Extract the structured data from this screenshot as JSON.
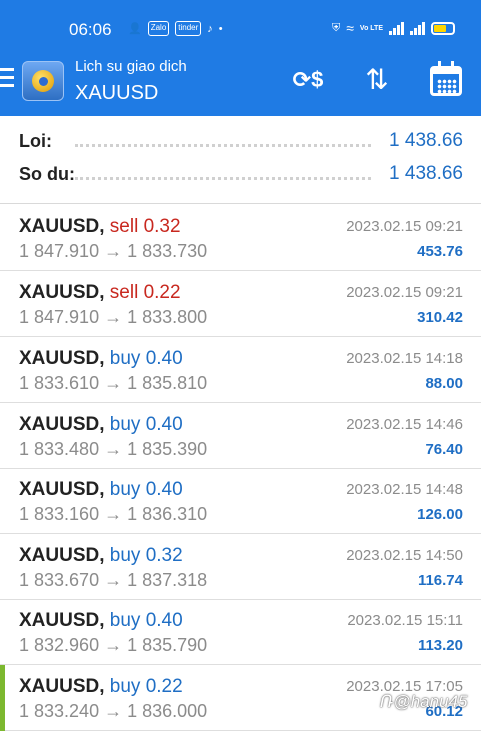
{
  "status_bar": {
    "time": "06:06",
    "left_icons": [
      "contacts-icon",
      "zalo-icon",
      "tinder-icon",
      "tiktok-icon",
      "dot-icon"
    ],
    "zalo_label": "Zalo",
    "tinder_label": "tinder",
    "right_icons": [
      "shield-icon",
      "wifi-icon",
      "lte-icon",
      "signal-icon",
      "signal-icon",
      "battery-icon"
    ],
    "lte_label": "Vo LTE",
    "battery_color": "#ffd600"
  },
  "header": {
    "title": "Lich su giao dich",
    "symbol": "XAUUSD",
    "background": "#1f7be4"
  },
  "summary": {
    "profit_label": "Loi:",
    "profit_value": "1 438.66",
    "balance_label": "So du:",
    "balance_value": "1 438.66"
  },
  "colors": {
    "sell": "#c8281f",
    "buy": "#1f6ec4",
    "price_text": "#8b8b8b",
    "profit_text": "#1f6ec4",
    "selected_marker": "#7cb82f"
  },
  "deals": [
    {
      "symbol": "XAUUSD,",
      "action": "sell 0.32",
      "prices": "1 847.910 → 1 833.730",
      "time": "2023.02.15 09:21",
      "profit": "453.76"
    },
    {
      "symbol": "XAUUSD,",
      "action": "sell 0.22",
      "prices": "1 847.910 → 1 833.800",
      "time": "2023.02.15 09:21",
      "profit": "310.42"
    },
    {
      "symbol": "XAUUSD,",
      "action": "buy 0.40",
      "prices": "1 833.610 → 1 835.810",
      "time": "2023.02.15 14:18",
      "profit": "88.00"
    },
    {
      "symbol": "XAUUSD,",
      "action": "buy 0.40",
      "prices": "1 833.480 → 1 835.390",
      "time": "2023.02.15 14:46",
      "profit": "76.40"
    },
    {
      "symbol": "XAUUSD,",
      "action": "buy 0.40",
      "prices": "1 833.160 → 1 836.310",
      "time": "2023.02.15 14:48",
      "profit": "126.00"
    },
    {
      "symbol": "XAUUSD,",
      "action": "buy 0.32",
      "prices": "1 833.670 → 1 837.318",
      "time": "2023.02.15 14:50",
      "profit": "116.74"
    },
    {
      "symbol": "XAUUSD,",
      "action": "buy 0.40",
      "prices": "1 832.960 → 1 835.790",
      "time": "2023.02.15 15:11",
      "profit": "113.20"
    },
    {
      "symbol": "XAUUSD,",
      "action": "buy 0.22",
      "prices": "1 833.240 → 1 836.000",
      "time": "2023.02.15 17:05",
      "profit": "60.12"
    }
  ],
  "watermark": "Ռ@hanu45"
}
